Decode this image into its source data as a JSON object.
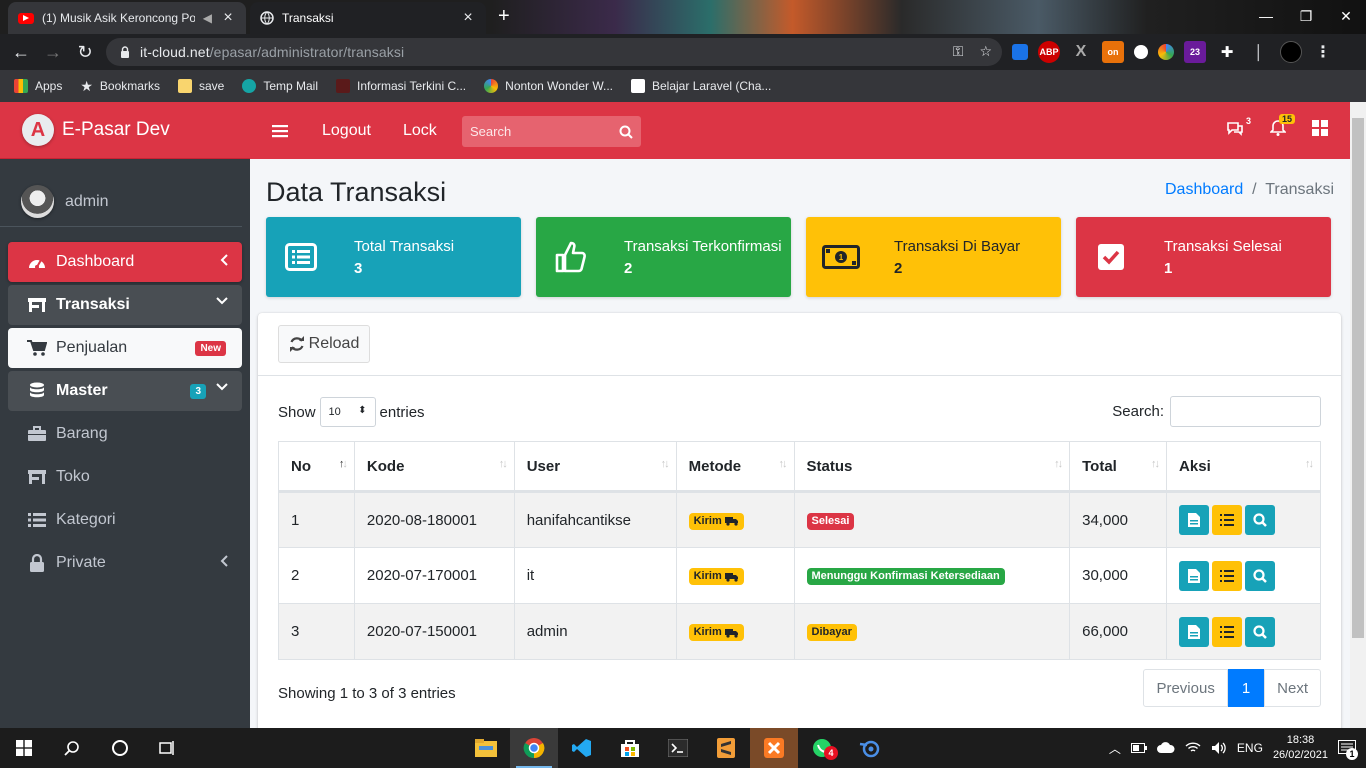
{
  "browser": {
    "tabs": [
      {
        "title": "(1) Musik Asik Keroncong Po",
        "active": false
      },
      {
        "title": "Transaksi",
        "active": true
      }
    ],
    "url_host": "it-cloud.net",
    "url_path": "/epasar/administrator/transaksi",
    "bookmarks": [
      "Apps",
      "Bookmarks",
      "save",
      "Temp Mail",
      "Informasi Terkini C...",
      "Nonton Wonder W...",
      "Belajar Laravel (Cha..."
    ],
    "ext_badges": {
      "on": "on",
      "count": "23",
      "abp": "ABP"
    }
  },
  "brand": {
    "name": "E-Pasar Dev",
    "logo_letter": "A"
  },
  "topnav": {
    "logout": "Logout",
    "lock": "Lock",
    "search_placeholder": "Search",
    "messages_count": "3",
    "notif_count": "15"
  },
  "sidebar": {
    "user": "admin",
    "items": [
      {
        "label": "Dashboard",
        "icon": "tachometer-icon"
      },
      {
        "label": "Transaksi",
        "icon": "store-icon"
      },
      {
        "label": "Penjualan",
        "icon": "cart-icon",
        "badge": "New"
      },
      {
        "label": "Master",
        "icon": "database-icon",
        "badge": "3"
      },
      {
        "label": "Barang",
        "icon": "briefcase-icon"
      },
      {
        "label": "Toko",
        "icon": "store-icon"
      },
      {
        "label": "Kategori",
        "icon": "list-icon"
      },
      {
        "label": "Private",
        "icon": "lock-icon"
      }
    ]
  },
  "page": {
    "title": "Data Transaksi",
    "breadcrumb": {
      "home": "Dashboard",
      "current": "Transaksi"
    },
    "boxes": [
      {
        "label": "Total Transaksi",
        "value": "3",
        "color": "#17a2b8",
        "icon": "list-alt-icon"
      },
      {
        "label": "Transaksi Terkonfirmasi",
        "value": "2",
        "color": "#28a745",
        "icon": "thumbs-up-icon"
      },
      {
        "label": "Transaksi Di Bayar",
        "value": "2",
        "color": "#ffc107",
        "icon": "money-bill-icon"
      },
      {
        "label": "Transaksi Selesai",
        "value": "1",
        "color": "#dc3545",
        "icon": "check-square-icon"
      }
    ],
    "reload": "Reload",
    "show_label": "Show",
    "entries_value": "10",
    "entries_label": "entries",
    "search_label": "Search:",
    "columns": [
      "No",
      "Kode",
      "User",
      "Metode",
      "Status",
      "Total",
      "Aksi"
    ],
    "rows": [
      {
        "no": "1",
        "kode": "2020-08-180001",
        "user": "hanifahcantikse",
        "metode": "Kirim",
        "status": "Selesai",
        "status_color": "#dc3545",
        "total": "34,000"
      },
      {
        "no": "2",
        "kode": "2020-07-170001",
        "user": "it",
        "metode": "Kirim",
        "status": "Menunggu Konfirmasi Ketersediaan",
        "status_color": "#28a745",
        "total": "30,000"
      },
      {
        "no": "3",
        "kode": "2020-07-150001",
        "user": "admin",
        "metode": "Kirim",
        "status": "Dibayar",
        "status_color": "#ffc107",
        "total": "66,000"
      }
    ],
    "info": "Showing 1 to 3 of 3 entries",
    "pager": {
      "prev": "Previous",
      "current": "1",
      "next": "Next"
    }
  },
  "taskbar": {
    "lang": "ENG",
    "time": "18:38",
    "date": "26/02/2021",
    "whatsapp_badge": "4",
    "notif": "1"
  }
}
